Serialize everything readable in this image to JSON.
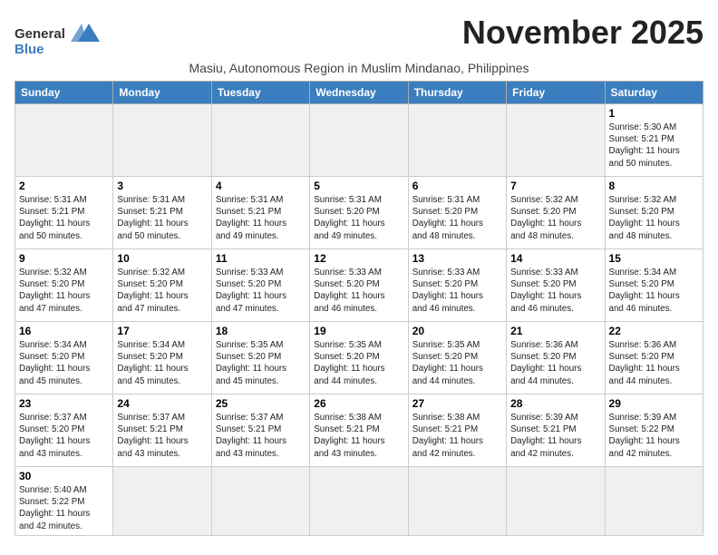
{
  "header": {
    "logo_general": "General",
    "logo_blue": "Blue",
    "month_title": "November 2025",
    "subtitle": "Masiu, Autonomous Region in Muslim Mindanao, Philippines"
  },
  "days_of_week": [
    "Sunday",
    "Monday",
    "Tuesday",
    "Wednesday",
    "Thursday",
    "Friday",
    "Saturday"
  ],
  "weeks": [
    [
      {
        "day": "",
        "info": ""
      },
      {
        "day": "",
        "info": ""
      },
      {
        "day": "",
        "info": ""
      },
      {
        "day": "",
        "info": ""
      },
      {
        "day": "",
        "info": ""
      },
      {
        "day": "",
        "info": ""
      },
      {
        "day": "1",
        "info": "Sunrise: 5:30 AM\nSunset: 5:21 PM\nDaylight: 11 hours\nand 50 minutes."
      }
    ],
    [
      {
        "day": "2",
        "info": "Sunrise: 5:31 AM\nSunset: 5:21 PM\nDaylight: 11 hours\nand 50 minutes."
      },
      {
        "day": "3",
        "info": "Sunrise: 5:31 AM\nSunset: 5:21 PM\nDaylight: 11 hours\nand 50 minutes."
      },
      {
        "day": "4",
        "info": "Sunrise: 5:31 AM\nSunset: 5:21 PM\nDaylight: 11 hours\nand 49 minutes."
      },
      {
        "day": "5",
        "info": "Sunrise: 5:31 AM\nSunset: 5:20 PM\nDaylight: 11 hours\nand 49 minutes."
      },
      {
        "day": "6",
        "info": "Sunrise: 5:31 AM\nSunset: 5:20 PM\nDaylight: 11 hours\nand 48 minutes."
      },
      {
        "day": "7",
        "info": "Sunrise: 5:32 AM\nSunset: 5:20 PM\nDaylight: 11 hours\nand 48 minutes."
      },
      {
        "day": "8",
        "info": "Sunrise: 5:32 AM\nSunset: 5:20 PM\nDaylight: 11 hours\nand 48 minutes."
      }
    ],
    [
      {
        "day": "9",
        "info": "Sunrise: 5:32 AM\nSunset: 5:20 PM\nDaylight: 11 hours\nand 47 minutes."
      },
      {
        "day": "10",
        "info": "Sunrise: 5:32 AM\nSunset: 5:20 PM\nDaylight: 11 hours\nand 47 minutes."
      },
      {
        "day": "11",
        "info": "Sunrise: 5:33 AM\nSunset: 5:20 PM\nDaylight: 11 hours\nand 47 minutes."
      },
      {
        "day": "12",
        "info": "Sunrise: 5:33 AM\nSunset: 5:20 PM\nDaylight: 11 hours\nand 46 minutes."
      },
      {
        "day": "13",
        "info": "Sunrise: 5:33 AM\nSunset: 5:20 PM\nDaylight: 11 hours\nand 46 minutes."
      },
      {
        "day": "14",
        "info": "Sunrise: 5:33 AM\nSunset: 5:20 PM\nDaylight: 11 hours\nand 46 minutes."
      },
      {
        "day": "15",
        "info": "Sunrise: 5:34 AM\nSunset: 5:20 PM\nDaylight: 11 hours\nand 46 minutes."
      }
    ],
    [
      {
        "day": "16",
        "info": "Sunrise: 5:34 AM\nSunset: 5:20 PM\nDaylight: 11 hours\nand 45 minutes."
      },
      {
        "day": "17",
        "info": "Sunrise: 5:34 AM\nSunset: 5:20 PM\nDaylight: 11 hours\nand 45 minutes."
      },
      {
        "day": "18",
        "info": "Sunrise: 5:35 AM\nSunset: 5:20 PM\nDaylight: 11 hours\nand 45 minutes."
      },
      {
        "day": "19",
        "info": "Sunrise: 5:35 AM\nSunset: 5:20 PM\nDaylight: 11 hours\nand 44 minutes."
      },
      {
        "day": "20",
        "info": "Sunrise: 5:35 AM\nSunset: 5:20 PM\nDaylight: 11 hours\nand 44 minutes."
      },
      {
        "day": "21",
        "info": "Sunrise: 5:36 AM\nSunset: 5:20 PM\nDaylight: 11 hours\nand 44 minutes."
      },
      {
        "day": "22",
        "info": "Sunrise: 5:36 AM\nSunset: 5:20 PM\nDaylight: 11 hours\nand 44 minutes."
      }
    ],
    [
      {
        "day": "23",
        "info": "Sunrise: 5:37 AM\nSunset: 5:20 PM\nDaylight: 11 hours\nand 43 minutes."
      },
      {
        "day": "24",
        "info": "Sunrise: 5:37 AM\nSunset: 5:21 PM\nDaylight: 11 hours\nand 43 minutes."
      },
      {
        "day": "25",
        "info": "Sunrise: 5:37 AM\nSunset: 5:21 PM\nDaylight: 11 hours\nand 43 minutes."
      },
      {
        "day": "26",
        "info": "Sunrise: 5:38 AM\nSunset: 5:21 PM\nDaylight: 11 hours\nand 43 minutes."
      },
      {
        "day": "27",
        "info": "Sunrise: 5:38 AM\nSunset: 5:21 PM\nDaylight: 11 hours\nand 42 minutes."
      },
      {
        "day": "28",
        "info": "Sunrise: 5:39 AM\nSunset: 5:21 PM\nDaylight: 11 hours\nand 42 minutes."
      },
      {
        "day": "29",
        "info": "Sunrise: 5:39 AM\nSunset: 5:22 PM\nDaylight: 11 hours\nand 42 minutes."
      }
    ],
    [
      {
        "day": "30",
        "info": "Sunrise: 5:40 AM\nSunset: 5:22 PM\nDaylight: 11 hours\nand 42 minutes."
      },
      {
        "day": "",
        "info": ""
      },
      {
        "day": "",
        "info": ""
      },
      {
        "day": "",
        "info": ""
      },
      {
        "day": "",
        "info": ""
      },
      {
        "day": "",
        "info": ""
      },
      {
        "day": "",
        "info": ""
      }
    ]
  ]
}
